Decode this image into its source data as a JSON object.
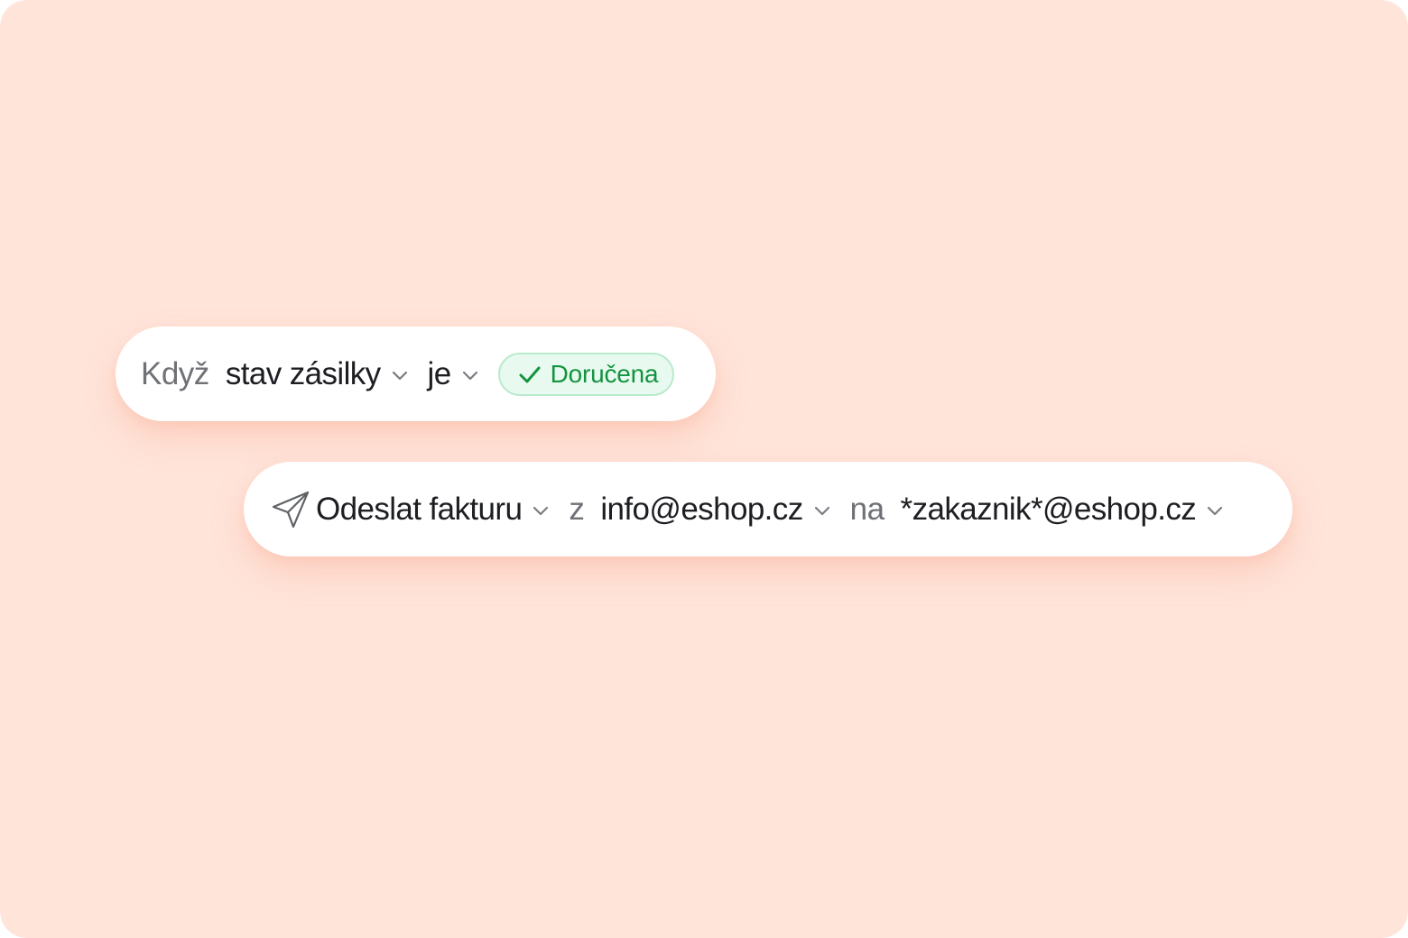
{
  "condition": {
    "when_label": "Když",
    "field": {
      "label": "stav zásilky",
      "icon": "chevron-down-icon"
    },
    "operator": {
      "label": "je",
      "icon": "chevron-down-icon"
    },
    "value_badge": {
      "label": "Doručena",
      "icon": "check-icon",
      "color": "#14933f",
      "background": "#e8faf0"
    }
  },
  "action": {
    "icon": "send-icon",
    "type": {
      "label": "Odeslat fakturu",
      "icon": "chevron-down-icon"
    },
    "from_label": "z",
    "from": {
      "label": "info@eshop.cz",
      "icon": "chevron-down-icon"
    },
    "to_label": "na",
    "to": {
      "label": "*zakaznik*@eshop.cz",
      "icon": "chevron-down-icon"
    }
  },
  "colors": {
    "background": "#ffe4da",
    "card": "#ffffff",
    "text_strong": "#1d1e22",
    "text_muted": "#6f7176"
  }
}
